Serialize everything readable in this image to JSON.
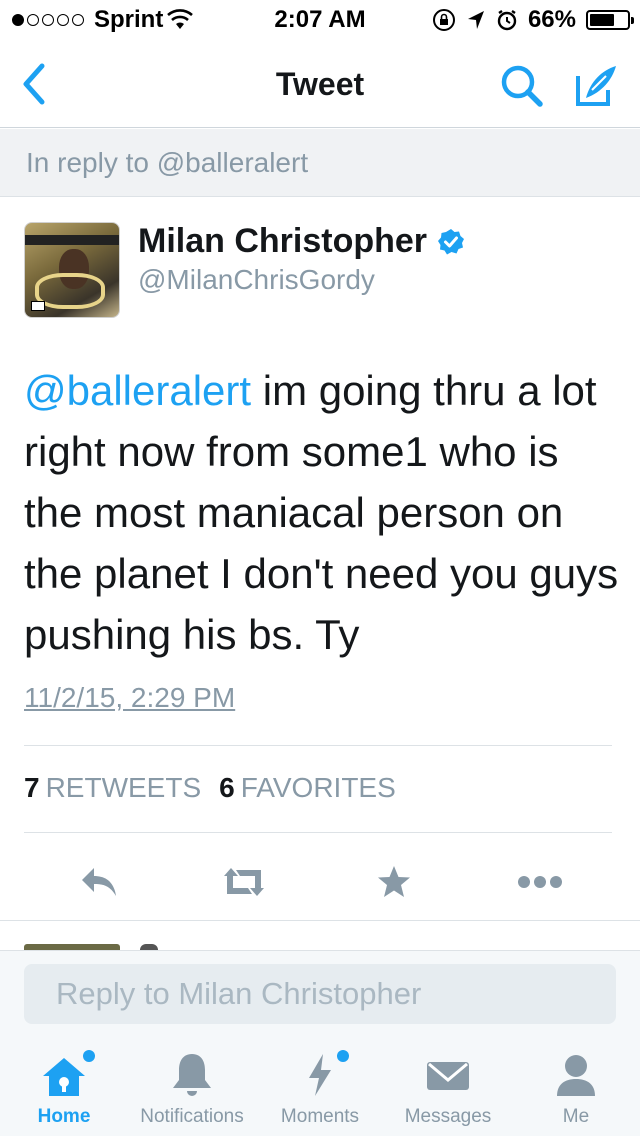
{
  "status_bar": {
    "carrier": "Sprint",
    "time": "2:07 AM",
    "battery": "66%",
    "battery_level": 0.66,
    "signal_bars_filled": 1,
    "signal_bars_total": 5
  },
  "nav": {
    "title": "Tweet",
    "back_icon": "chevron-left-icon",
    "search_icon": "search-icon",
    "compose_icon": "compose-icon",
    "accent": "#1da1f2"
  },
  "reply_banner": {
    "text": "In reply to @balleralert"
  },
  "tweet": {
    "user_name": "Milan Christopher",
    "handle": "@MilanChrisGordy",
    "verified": true,
    "mention": "@balleralert",
    "body": " im going thru a lot right now from some1 who is the most maniacal person on the planet I don't need you guys pushing his bs. Ty",
    "timestamp": "11/2/15, 2:29 PM",
    "retweets_count": "7",
    "retweets_label": "RETWEETS",
    "favorites_count": "6",
    "favorites_label": "FAVORITES"
  },
  "composer": {
    "placeholder": "Reply to Milan Christopher"
  },
  "tabs": [
    {
      "label": "Home",
      "icon": "home-icon",
      "active": true,
      "has_badge": true
    },
    {
      "label": "Notifications",
      "icon": "bell-icon",
      "active": false,
      "has_badge": false
    },
    {
      "label": "Moments",
      "icon": "lightning-icon",
      "active": false,
      "has_badge": true
    },
    {
      "label": "Messages",
      "icon": "envelope-icon",
      "active": false,
      "has_badge": false
    },
    {
      "label": "Me",
      "icon": "person-icon",
      "active": false,
      "has_badge": false
    }
  ],
  "colors": {
    "accent": "#1da1f2",
    "muted": "#8899a6",
    "text": "#14171a"
  }
}
